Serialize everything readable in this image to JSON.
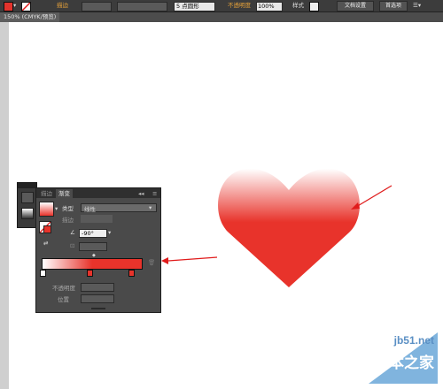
{
  "topbar": {
    "stroke_label": "描边",
    "points_label": "5 点圆形",
    "opacity_label": "不透明度",
    "opacity_value": "100%",
    "style_label": "样式",
    "doc_setup": "文档设置",
    "prefs": "首选项"
  },
  "document_tab": "150% (CMYK/预览)",
  "panel": {
    "tab_stroke": "描边",
    "tab_gradient": "渐变",
    "type_label": "类型",
    "type_value": "线性",
    "stroke_label": "描边",
    "angle_value": "-90°",
    "opacity_label": "不透明度",
    "position_label": "位置"
  },
  "watermark": {
    "site": "jb51.net",
    "name": "脚本之家"
  },
  "colors": {
    "gradient_start": "#ffffff",
    "gradient_end": "#e8332b",
    "arrow": "#e01b1b"
  }
}
